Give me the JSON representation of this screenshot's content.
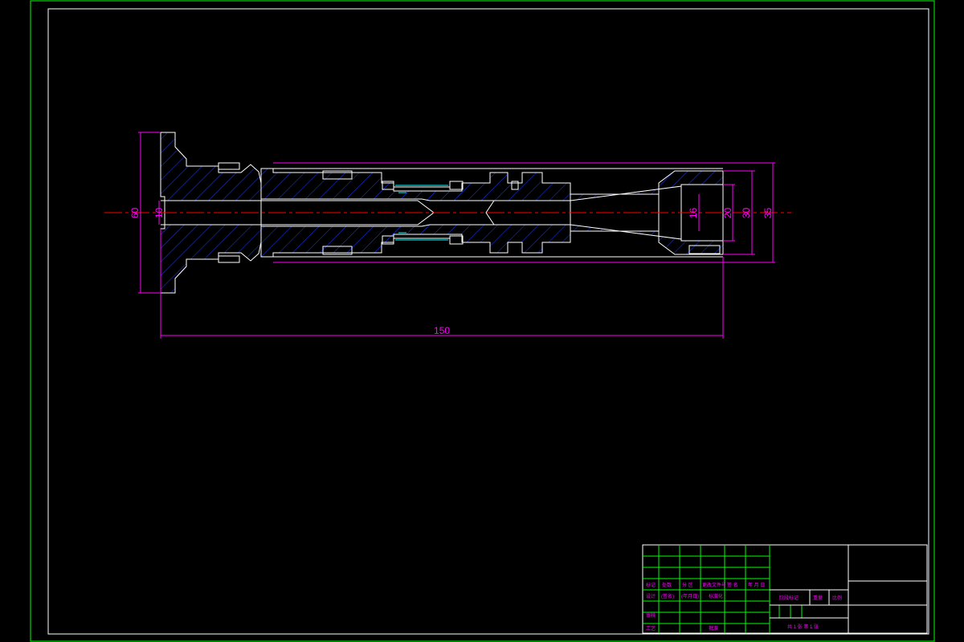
{
  "colors": {
    "background": "#000000",
    "outer_frame": "#00ff00",
    "inner_frame": "#ffffff",
    "part_outline": "#ffffff",
    "hatch": "#1a3cff",
    "dimension": "#ff00ff",
    "centerline": "#ff0000",
    "title_block_grid": "#00ff00",
    "title_block_text": "#ff00ff"
  },
  "dimensions": {
    "overall_length": "150",
    "flange_diameter": "60",
    "bore_diameter": "10",
    "d16": "16",
    "d20": "20",
    "d30": "30",
    "d35": "35"
  },
  "title_block": {
    "drawing_title": "",
    "part_name": "",
    "rows": [
      [
        "标记",
        "处数",
        "分 区",
        "更改文件号",
        "签 名",
        "年 月 日"
      ],
      [
        "设计",
        "(签名)",
        "(年月日)",
        "标准化",
        "",
        ""
      ],
      [
        "审核",
        "",
        "",
        "",
        "",
        ""
      ],
      [
        "工艺",
        "",
        "",
        "批准",
        "",
        ""
      ]
    ],
    "stage_label": "阶段标记",
    "weight_label": "重量",
    "scale_label": "比例",
    "sheet_info": "共 1 张   第 1 张"
  }
}
